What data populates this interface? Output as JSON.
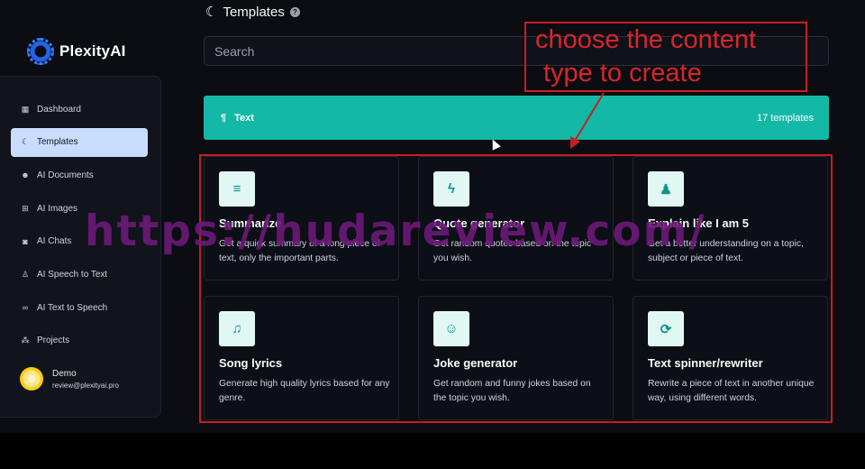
{
  "brand": {
    "name": "PlexityAI"
  },
  "header": {
    "title": "Templates",
    "back_icon": "moon-icon",
    "info_icon": "info-icon"
  },
  "search": {
    "placeholder": "Search"
  },
  "sidebar": {
    "items": [
      {
        "label": "Dashboard",
        "icon": "grid-icon",
        "glyph": "▦"
      },
      {
        "label": "Templates",
        "icon": "moon-icon",
        "glyph": "☾"
      },
      {
        "label": "AI Documents",
        "icon": "robot-icon",
        "glyph": "☻"
      },
      {
        "label": "AI Images",
        "icon": "image-grid-icon",
        "glyph": "⊞"
      },
      {
        "label": "AI Chats",
        "icon": "chat-icon",
        "glyph": "◙"
      },
      {
        "label": "AI Speech to Text",
        "icon": "microphone-icon",
        "glyph": "♙"
      },
      {
        "label": "AI Text to Speech",
        "icon": "voicemail-icon",
        "glyph": "∞"
      },
      {
        "label": "Projects",
        "icon": "project-tree-icon",
        "glyph": "⁂"
      }
    ],
    "active_index": 1,
    "user": {
      "name": "Demo",
      "email": "review@plexityai.pro"
    }
  },
  "category": {
    "label": "Text",
    "icon": "paragraph-icon",
    "glyph": "¶",
    "count": "17 templates",
    "color": "#14b8a6"
  },
  "templates": [
    {
      "title": "Summarize",
      "description": "Get a quick summary of a long piece of text, only the important parts.",
      "icon": "align-left-icon",
      "glyph": "≡"
    },
    {
      "title": "Quote generator",
      "description": "Get random quotes based on the topic you wish.",
      "icon": "bolt-icon",
      "glyph": "ϟ"
    },
    {
      "title": "Explain like I am 5",
      "description": "Get a better understanding on a topic, subject or piece of text.",
      "icon": "child-icon",
      "glyph": "♟"
    },
    {
      "title": "Song lyrics",
      "description": "Generate high quality lyrics based for any genre.",
      "icon": "music-icon",
      "glyph": "♫"
    },
    {
      "title": "Joke generator",
      "description": "Get random and funny jokes based on the topic you wish.",
      "icon": "laugh-icon",
      "glyph": "☺"
    },
    {
      "title": "Text spinner/rewriter",
      "description": "Rewrite a piece of text in another unique way, using different words.",
      "icon": "refresh-icon",
      "glyph": "⟳"
    }
  ],
  "annotation": {
    "line1": "choose the content",
    "line2": "type to create",
    "color": "#c81e24"
  },
  "watermark": {
    "text": "https://hudareview.com/"
  }
}
